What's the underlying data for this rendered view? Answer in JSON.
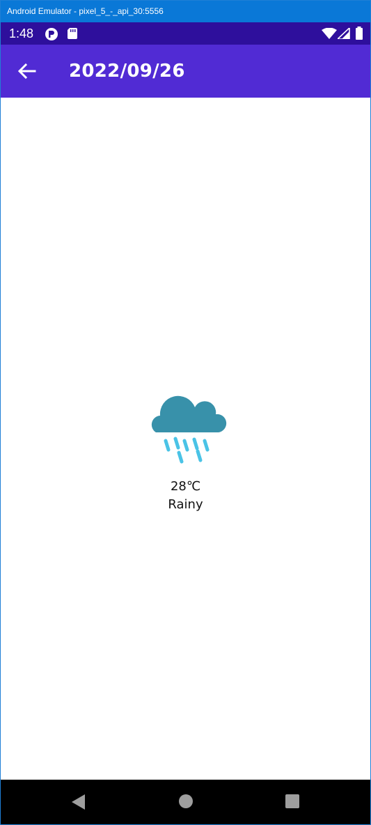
{
  "emulator": {
    "title": "Android Emulator - pixel_5_-_api_30:5556"
  },
  "status_bar": {
    "time": "1:48"
  },
  "app_bar": {
    "title": "2022/09/26"
  },
  "weather": {
    "icon": "rain-cloud-icon",
    "temperature": "28℃",
    "condition": "Rainy"
  },
  "nav_bar": {
    "buttons": [
      "back-triangle-icon",
      "home-circle-icon",
      "overview-square-icon"
    ]
  },
  "colors": {
    "status_bar": "#2e0f9c",
    "app_bar": "#512bd4",
    "cloud": "#3891aa",
    "rain": "#4ac3e6"
  }
}
